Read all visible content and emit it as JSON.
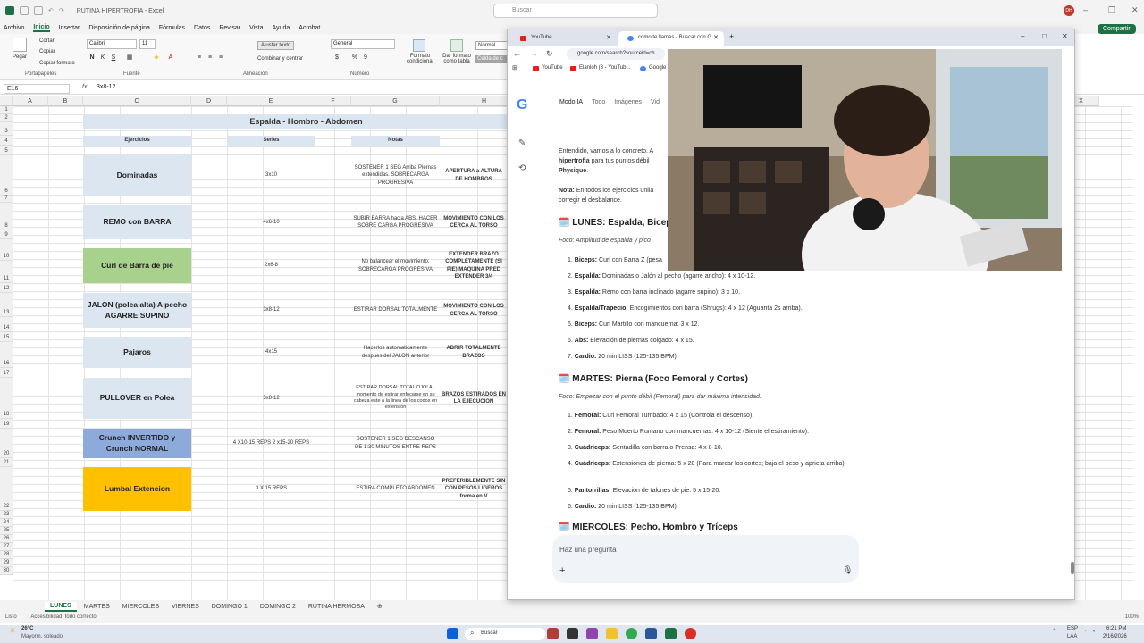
{
  "excel": {
    "title": "RUTINA HIPERTROFIA - Excel",
    "search_placeholder": "Buscar",
    "avatar": "DH",
    "share": "Compartir",
    "menu": [
      "Archivo",
      "Inicio",
      "Insertar",
      "Disposición de página",
      "Fórmulas",
      "Datos",
      "Revisar",
      "Vista",
      "Ayuda",
      "Acrobat"
    ],
    "ribbon": {
      "paste": "Pegar",
      "cut": "Cortar",
      "copy": "Copiar",
      "format_painter": "Copiar formato",
      "font": "Calibri",
      "font_size": "11",
      "wrap_text": "Ajustar texto",
      "merge": "Combinar y centrar",
      "number_format": "General",
      "conditional": "Formato condicional",
      "as_table": "Dar formato como tabla",
      "style_normal": "Normal",
      "style_check": "Celda de c",
      "groups": [
        "Portapapeles",
        "Fuente",
        "Alineación",
        "Número"
      ]
    },
    "name_box": "E16",
    "formula": "3x8-12",
    "columns": [
      "A",
      "B",
      "C",
      "D",
      "E",
      "F",
      "G",
      "H",
      "X"
    ],
    "rows": [
      "1",
      "2",
      "3",
      "4",
      "5",
      "6",
      "7",
      "8",
      "9",
      "10",
      "11",
      "12",
      "13",
      "14",
      "15",
      "16",
      "17",
      "18",
      "19",
      "20",
      "21",
      "22",
      "23",
      "24",
      "25",
      "26",
      "27",
      "28",
      "29",
      "30"
    ],
    "sheet_title": "Espalda - Hombro - Abdomen",
    "col_labels": {
      "ejercicios": "Ejercicios",
      "series": "Series",
      "notas": "Notas"
    },
    "exercises": [
      {
        "name": "Dominadas",
        "series": "3x10",
        "notes": "SOSTENER 1 SEG Arriba Piernas extendidas. SOBRECARGA PROGRESIVA",
        "extra": "APERTURA a ALTURA DE HOMBROS",
        "color": "#dce6f1"
      },
      {
        "name": "REMO con BARRA",
        "series": "4x6-10",
        "notes": "SUBIR BARRA hacia ABS. HACER SOBRE CARGA PROGRESIVA",
        "extra": "MOVIMIENTO CON LOS CERCA AL TORSO",
        "color": "#dce6f1"
      },
      {
        "name": "Curl de Barra de pie",
        "series": "2x6-8",
        "notes": "No balancear el movimiento. SOBRECARGA PROGRESIVA",
        "extra": "EXTENDER BRAZO COMPLETAMENTE (SI PIE) MAQUINA PRED EXTENDER 3/4",
        "color": "#a9d18e"
      },
      {
        "name": "JALON (polea alta) A pecho AGARRE SUPINO",
        "series": "3x8-12",
        "notes": "ESTIRAR DORSAL TOTALMENTE",
        "extra": "MOVIMIENTO CON LOS CERCA AL TORSO",
        "color": "#dce6f1"
      },
      {
        "name": "Pajaros",
        "series": "4x15",
        "notes": "Hacerlos automaticamente despues del JALON anterior",
        "extra": "ABRIR TOTALMENTE BRAZOS",
        "color": "#dce6f1"
      },
      {
        "name": "PULLOVER en Polea",
        "series": "3x8-12",
        "notes": "ESTIRAR DORSAL TOTAL OJO! AL momento de estirar enfocarse en su cabeza este a la linea de los codos en extension",
        "extra": "BRAZOS ESTIRADOS EN LA EJECUCION",
        "color": "#dce6f1"
      },
      {
        "name": "Crunch INVERTIDO y Crunch NORMAL",
        "series": "4 X10-15 REPS 2 x15-20 REPS",
        "notes": "SOSTENER 1 SEG DESCANSO DE 1:30 MINUTOS ENTRE REPS",
        "extra": "",
        "color": "#8eaadb"
      },
      {
        "name": "Lumbal Extencion",
        "series": "3 X 15 REPS",
        "notes": "ESTIRA COMPLETO ABDOMEN",
        "extra": "PREFERIBLEMENTE SIN CON PESOS LIGEROS forma en V",
        "color": "#ffc000"
      }
    ],
    "sheets": [
      "LUNES",
      "MARTES",
      "MIERCOLES",
      "VIERNES",
      "DOMINGO 1",
      "DOMINGO 2",
      "RUTINA HERMOSA"
    ],
    "status": "Listo",
    "accessibility": "Accesibilidad: todo correcto",
    "zoom": "100%"
  },
  "chrome": {
    "tabs": [
      {
        "label": "YouTube"
      },
      {
        "label": "como te llames - Buscar con G"
      }
    ],
    "url": "google.com/search?sourceid=ch",
    "bookmarks": [
      "YouTube",
      "Elanloh (3 - YouTub...",
      "Google"
    ],
    "google_tabs": [
      "Modo IA",
      "Todo",
      "Imágenes",
      "Vid"
    ],
    "intro": {
      "l1": "Entendido, vamos a lo concreto. A",
      "l2": "hipertrofia",
      "l2b": " para tus puntos débil",
      "l3": "Physique",
      "l3b": "."
    },
    "note": {
      "label": "Nota:",
      "text": " En todos los ejercicios unila",
      "text2": "corregir el desbalance."
    },
    "days": [
      {
        "title": "LUNES: Espalda, Bicep",
        "focus": "Foco: Amplitud de espalda y pico",
        "items": [
          {
            "label": "Biceps:",
            "text": " Curl con Barra Z (pesa"
          },
          {
            "label": "Espalda:",
            "text": " Dominadas o Jalón al pecho (agarre ancho): 4 x 10-12."
          },
          {
            "label": "Espalda:",
            "text": " Remo con barra inclinado (agarre supino): 3 x 10."
          },
          {
            "label": "Espalda/Trapecio:",
            "text": " Encogimientos con barra (Shrugs): 4 x 12 (Aguanta 2s arriba)."
          },
          {
            "label": "Biceps:",
            "text": " Curl Martillo con mancuerna: 3 x 12."
          },
          {
            "label": "Abs:",
            "text": " Elevación de piernas colgado: 4 x 15."
          },
          {
            "label": "Cardio:",
            "text": " 20 min LISS (125-135 BPM)."
          }
        ]
      },
      {
        "title": "MARTES: Pierna (Foco Femoral y Cortes)",
        "focus": "Foco: Empezar con el punto débil (Femoral) para dar máxima intensidad.",
        "items": [
          {
            "label": "Femoral:",
            "text": " Curl Femoral Tumbado: 4 x 15 (Controla el descenso)."
          },
          {
            "label": "Femoral:",
            "text": " Peso Muerto Rumano con mancuernas: 4 x 10-12 (Siente el estiramiento)."
          },
          {
            "label": "Cuádriceps:",
            "text": " Sentadilla con barra o Prensa: 4 x 8-10."
          },
          {
            "label": "Cuádriceps:",
            "text": " Extensiones de pierna: 5 x 20 (Para marcar los cortes; baja el peso y aprieta arriba)."
          },
          {
            "label": "Pantorrillas:",
            "text": " Elevación de talones de pie: 5 x 15-20."
          },
          {
            "label": "Cardio:",
            "text": " 20 min LISS (125-135 BPM)."
          }
        ]
      },
      {
        "title": "MIÉRCOLES: Pecho, Hombro y Tríceps"
      }
    ],
    "ask_placeholder": "Haz una pregunta"
  },
  "taskbar": {
    "weather_temp": "26°C",
    "weather_desc": "Mayorm. soleado",
    "search": "Buscar",
    "lang1": "ESP",
    "lang2": "LAA",
    "time": "6:21 PM",
    "date": "2/16/2026"
  }
}
